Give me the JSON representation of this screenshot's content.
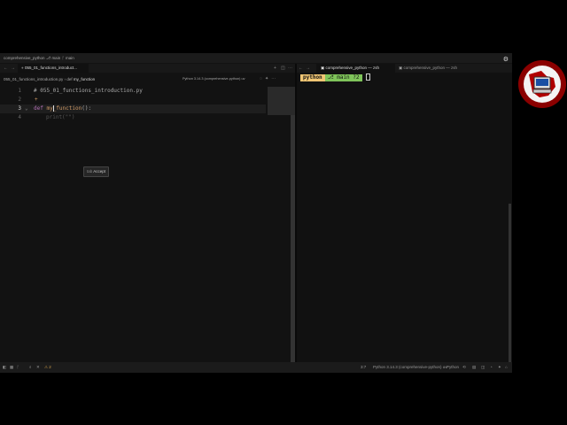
{
  "window": {
    "title": "comprehensive_python",
    "branch1": "main",
    "branch2": "main"
  },
  "tabs": [
    {
      "label": "055_01_functions_introduct..."
    },
    {
      "label": "comprehensive_python — zsh"
    },
    {
      "label": "comprehensive_python — zsh"
    }
  ],
  "breadcrumb": {
    "file": "055_01_functions_introduction.py",
    "sep": "›",
    "kind": "def",
    "symbol": "my_function"
  },
  "interpreter": "Python 3.14.3 (comprehensive-python) uv",
  "editor": {
    "lines": [
      {
        "num": "1",
        "text": "# 055_01_functions_introduction.py"
      },
      {
        "num": "2",
        "text": ""
      },
      {
        "num": "3",
        "kw": "def",
        "name": "my_function",
        "after": "():"
      },
      {
        "num": "4",
        "ghost": "print(\"\")"
      }
    ],
    "fold_marker": "⌄",
    "add_marker": "+"
  },
  "completion": {
    "key": "tab",
    "action": "Accept"
  },
  "terminal": {
    "env": "python",
    "git": "⎇ main ?2"
  },
  "statusbar": {
    "cursor": "3:7",
    "interpreter": "Python 3.14.3 (comprehensive-python) uv",
    "lang": "Python",
    "warnings": "2"
  },
  "colors": {
    "accent_env": "#f0c674",
    "accent_git": "#7fc45a",
    "keyword": "#b06fb3",
    "function": "#d19a66"
  },
  "icons": [
    "gear-icon",
    "back-icon",
    "forward-icon",
    "plus-icon",
    "split-icon",
    "more-icon",
    "branch-icon",
    "warning-icon",
    "bell-icon"
  ]
}
